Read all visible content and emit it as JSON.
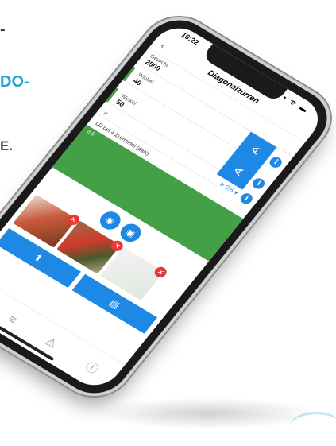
{
  "side_text": [
    "-",
    "DO-",
    "E."
  ],
  "status": {
    "time": "16:22",
    "icons": "▪ ᯤ ▬"
  },
  "nav": {
    "back": "‹",
    "title": "Diagonalzurren"
  },
  "fields": {
    "gewicht": {
      "label": "Gewicht",
      "value": "2500"
    },
    "winkel1": {
      "label": "Winkel",
      "value": "40"
    },
    "winkel2": {
      "label": "Winkel",
      "value": "50"
    },
    "mu": {
      "label": "μ",
      "dropdown": "≥ 0,6 ▾"
    }
  },
  "lc": {
    "label": "LC bei 4 Zurrmittel (daN)",
    "bar_text": "≥ 0"
  },
  "glyphs": {
    "angle": "∢",
    "info": "i",
    "camera": "◉",
    "image": "▣",
    "remove": "✕",
    "upload": "⬆",
    "pdf": "▤"
  },
  "tabs": [
    {
      "name": "home",
      "glyph": "⌂"
    },
    {
      "name": "list",
      "glyph": "≡"
    },
    {
      "name": "warning",
      "glyph": "⚠"
    },
    {
      "name": "info",
      "glyph": "ⓘ"
    }
  ],
  "colors": {
    "accent": "#1e88e5",
    "green": "#43a047",
    "remove": "#e53935",
    "side_dark": "#2a3d66",
    "side_light": "#1fa3d9"
  }
}
